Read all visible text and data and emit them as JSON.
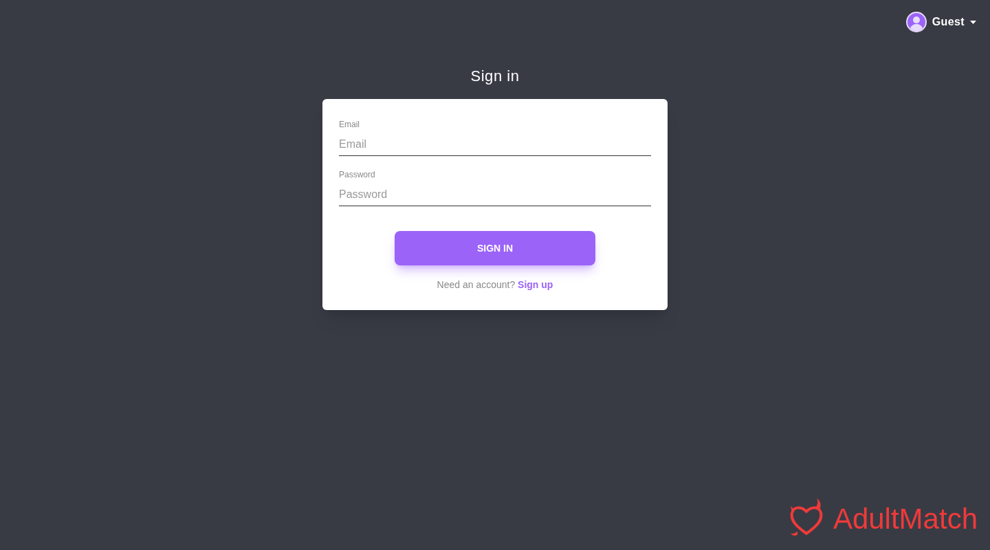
{
  "user_menu": {
    "label": "Guest"
  },
  "heading": "Sign in",
  "form": {
    "fields": [
      {
        "label": "Email",
        "placeholder": "Email"
      },
      {
        "label": "Password",
        "placeholder": "Password"
      }
    ],
    "submit": "SIGN IN",
    "signup_prompt": "Need an account?",
    "signup_link": "Sign up"
  },
  "logo": {
    "text": "AdultMatch"
  }
}
